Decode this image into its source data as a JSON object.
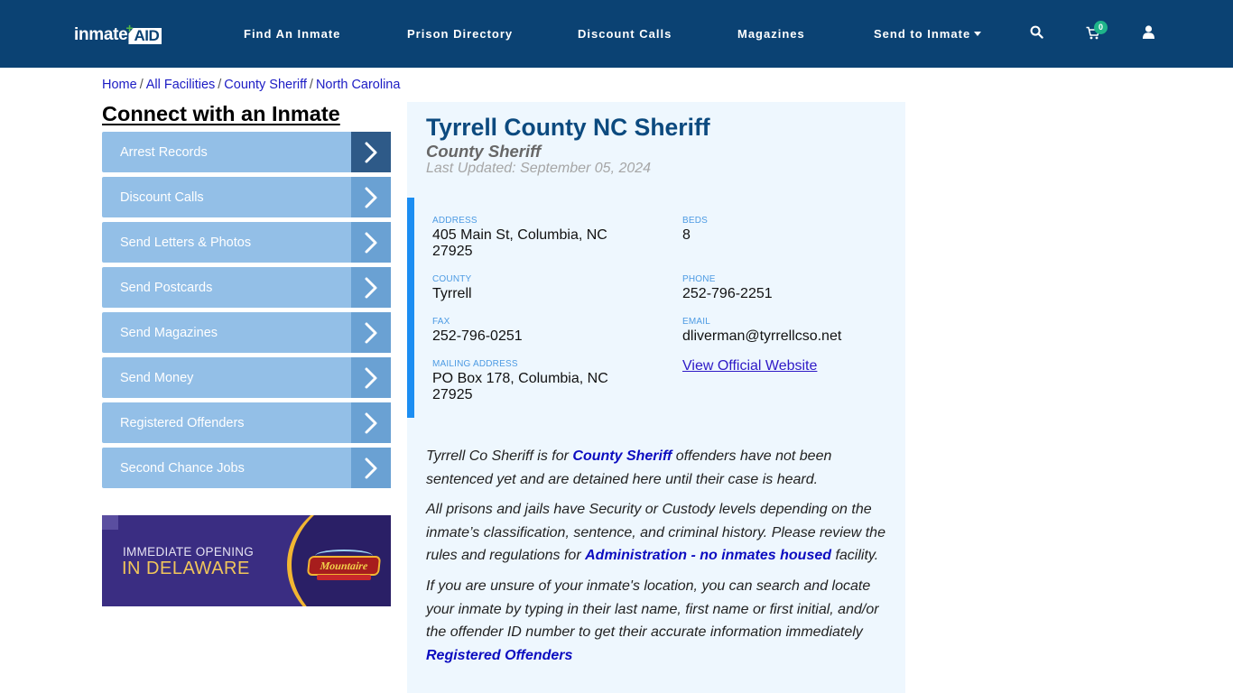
{
  "header": {
    "logo": {
      "text_main": "inmate",
      "text_accent": "AID",
      "plus": "+"
    },
    "nav": [
      {
        "label": "Find An Inmate"
      },
      {
        "label": "Prison Directory"
      },
      {
        "label": "Discount Calls"
      },
      {
        "label": "Magazines"
      },
      {
        "label": "Send to Inmate",
        "has_dropdown": true
      }
    ],
    "icons": {
      "search": "search-icon",
      "cart": "cart-icon",
      "user": "user-icon"
    },
    "cart_count": "0",
    "colors": {
      "navbar_bg": "#0b4273",
      "badge": "#1fb48a"
    }
  },
  "breadcrumb": [
    {
      "label": "Home"
    },
    {
      "label": "All Facilities"
    },
    {
      "label": "County Sheriff"
    },
    {
      "label": "North Carolina"
    }
  ],
  "sidebar": {
    "title": "Connect with an Inmate",
    "items": [
      {
        "label": "Arrest Records",
        "active": true
      },
      {
        "label": "Discount Calls"
      },
      {
        "label": "Send Letters & Photos"
      },
      {
        "label": "Send Postcards"
      },
      {
        "label": "Send Magazines"
      },
      {
        "label": "Send Money"
      },
      {
        "label": "Registered Offenders"
      },
      {
        "label": "Second Chance Jobs"
      }
    ],
    "ad": {
      "line1": "IMMEDIATE OPENING",
      "line2": "IN DELAWARE",
      "brand": "Mountaire"
    }
  },
  "facility": {
    "name": "Tyrrell County NC Sheriff",
    "type": "County Sheriff",
    "last_updated": "Last Updated: September 05, 2024",
    "fields": {
      "address": {
        "label": "ADDRESS",
        "value_line1": "405 Main St, Columbia, NC",
        "value_line2": "27925"
      },
      "beds": {
        "label": "BEDS",
        "value": "8"
      },
      "county": {
        "label": "COUNTY",
        "value": "Tyrrell"
      },
      "phone": {
        "label": "PHONE",
        "value": "252-796-2251"
      },
      "fax": {
        "label": "FAX",
        "value": "252-796-0251"
      },
      "email": {
        "label": "EMAIL",
        "value": "dliverman@tyrrellcso.net"
      },
      "mailing": {
        "label": "MAILING ADDRESS",
        "value_line1": "PO Box 178, Columbia, NC",
        "value_line2": "27925"
      },
      "website_link": "View Official Website"
    },
    "description": {
      "p1_a": "Tyrrell Co Sheriff is for ",
      "p1_link": "County Sheriff",
      "p1_b": " offenders have not been sentenced yet and are detained here until their case is heard.",
      "p2_a": "All prisons and jails have Security or Custody levels depending on the inmate’s classification, sentence, and criminal history. Please review the rules and regulations for ",
      "p2_link": "Administration - no inmates housed",
      "p2_b": " facility.",
      "p3": "If you are unsure of your inmate's location, you can search and locate your inmate by typing in their last name, first name or first initial, and/or the offender ID number to get their accurate information immediately",
      "p3_link": "Registered Offenders"
    }
  }
}
